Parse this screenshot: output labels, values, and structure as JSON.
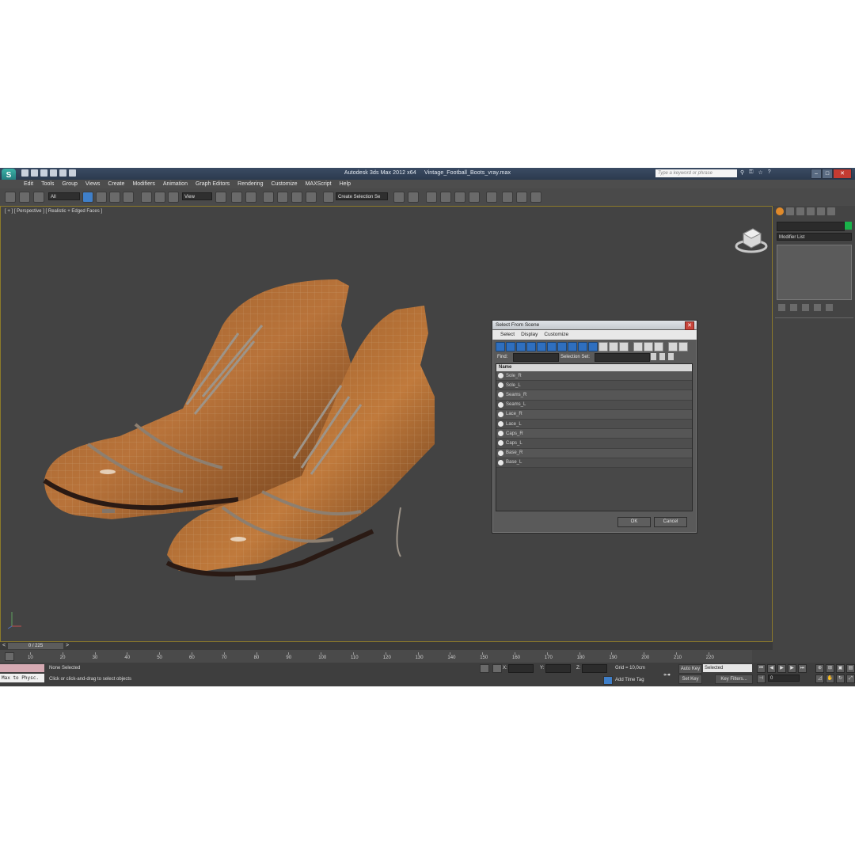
{
  "window": {
    "app_title": "Autodesk 3ds Max  2012 x64",
    "file_name": "Vintage_Football_Boots_vray.max",
    "search_placeholder": "Type a keyword or phrase",
    "logo_letter": "S",
    "controls": {
      "minimize": "–",
      "maximize": "□",
      "close": "✕"
    }
  },
  "menu": [
    "Edit",
    "Tools",
    "Group",
    "Views",
    "Create",
    "Modifiers",
    "Animation",
    "Graph Editors",
    "Rendering",
    "Customize",
    "MAXScript",
    "Help"
  ],
  "toolbar": {
    "selection_filter": "All",
    "reference_coord": "View",
    "named_selection": "Create Selection Se"
  },
  "viewport": {
    "label": "[ + ] [ Perspective ] [ Realistic + Edged Faces ]"
  },
  "command_panel": {
    "modifier_list": "Modifier List",
    "name_color": "#19b34a"
  },
  "dialog": {
    "title": "Select From Scene",
    "close": "✕",
    "menu": [
      "Select",
      "Display",
      "Customize"
    ],
    "find_label": "Find:",
    "selection_set_label": "Selection Set:",
    "column_name": "Name",
    "items": [
      "Sole_R",
      "Sole_L",
      "Seams_R",
      "Seams_L",
      "Lace_R",
      "Lace_L",
      "Caps_R",
      "Caps_L",
      "Base_R",
      "Base_L"
    ],
    "ok": "OK",
    "cancel": "Cancel"
  },
  "timeline": {
    "frame": "0 / 225",
    "ticks": [
      "10",
      "20",
      "30",
      "40",
      "50",
      "60",
      "70",
      "80",
      "90",
      "100",
      "110",
      "120",
      "130",
      "140",
      "150",
      "160",
      "170",
      "180",
      "190",
      "200",
      "210",
      "220"
    ]
  },
  "status": {
    "maxscript_listener": "Max to Physc.",
    "selection": "None Selected",
    "prompt": "Click or click-and-drag to select objects",
    "x_label": "X:",
    "y_label": "Y:",
    "z_label": "Z:",
    "grid": "Grid = 10,0cm",
    "add_time_tag": "Add Time Tag",
    "auto_key": "Auto Key",
    "set_key": "Set Key",
    "key_mode": "Selected",
    "key_filters": "Key Filters...",
    "frame_value": "0"
  }
}
